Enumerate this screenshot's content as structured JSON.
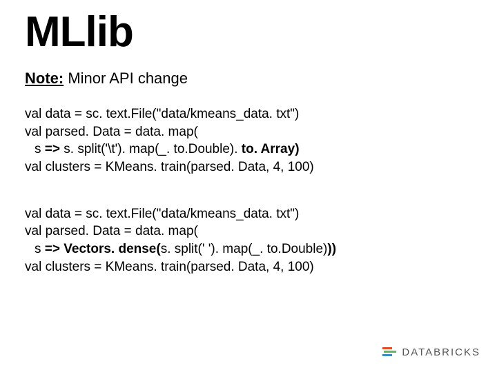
{
  "title": "MLlib",
  "note": {
    "label": "Note:",
    "text": " Minor API change"
  },
  "code1": {
    "l1": "val data = sc. text.File(\"data/kmeans_data. txt\")",
    "l2": "val parsed. Data = data. map(",
    "l3a": "s ",
    "l3b": "=>",
    "l3c": " s. split('\\t'). map(_. to.Double). ",
    "l3d": "to. Array)",
    "l4": "val clusters = KMeans. train(parsed. Data, 4, 100)"
  },
  "code2": {
    "l1": "val data = sc. text.File(\"data/kmeans_data. txt\")",
    "l2": "val parsed. Data = data. map(",
    "l3a": "s ",
    "l3b": "=> Vectors. dense(",
    "l3c": "s. split(' '). map(_. to.Double)",
    "l3d": "))",
    "l4": "val clusters = KMeans. train(parsed. Data, 4, 100)"
  },
  "logo": "DATABRICKS"
}
